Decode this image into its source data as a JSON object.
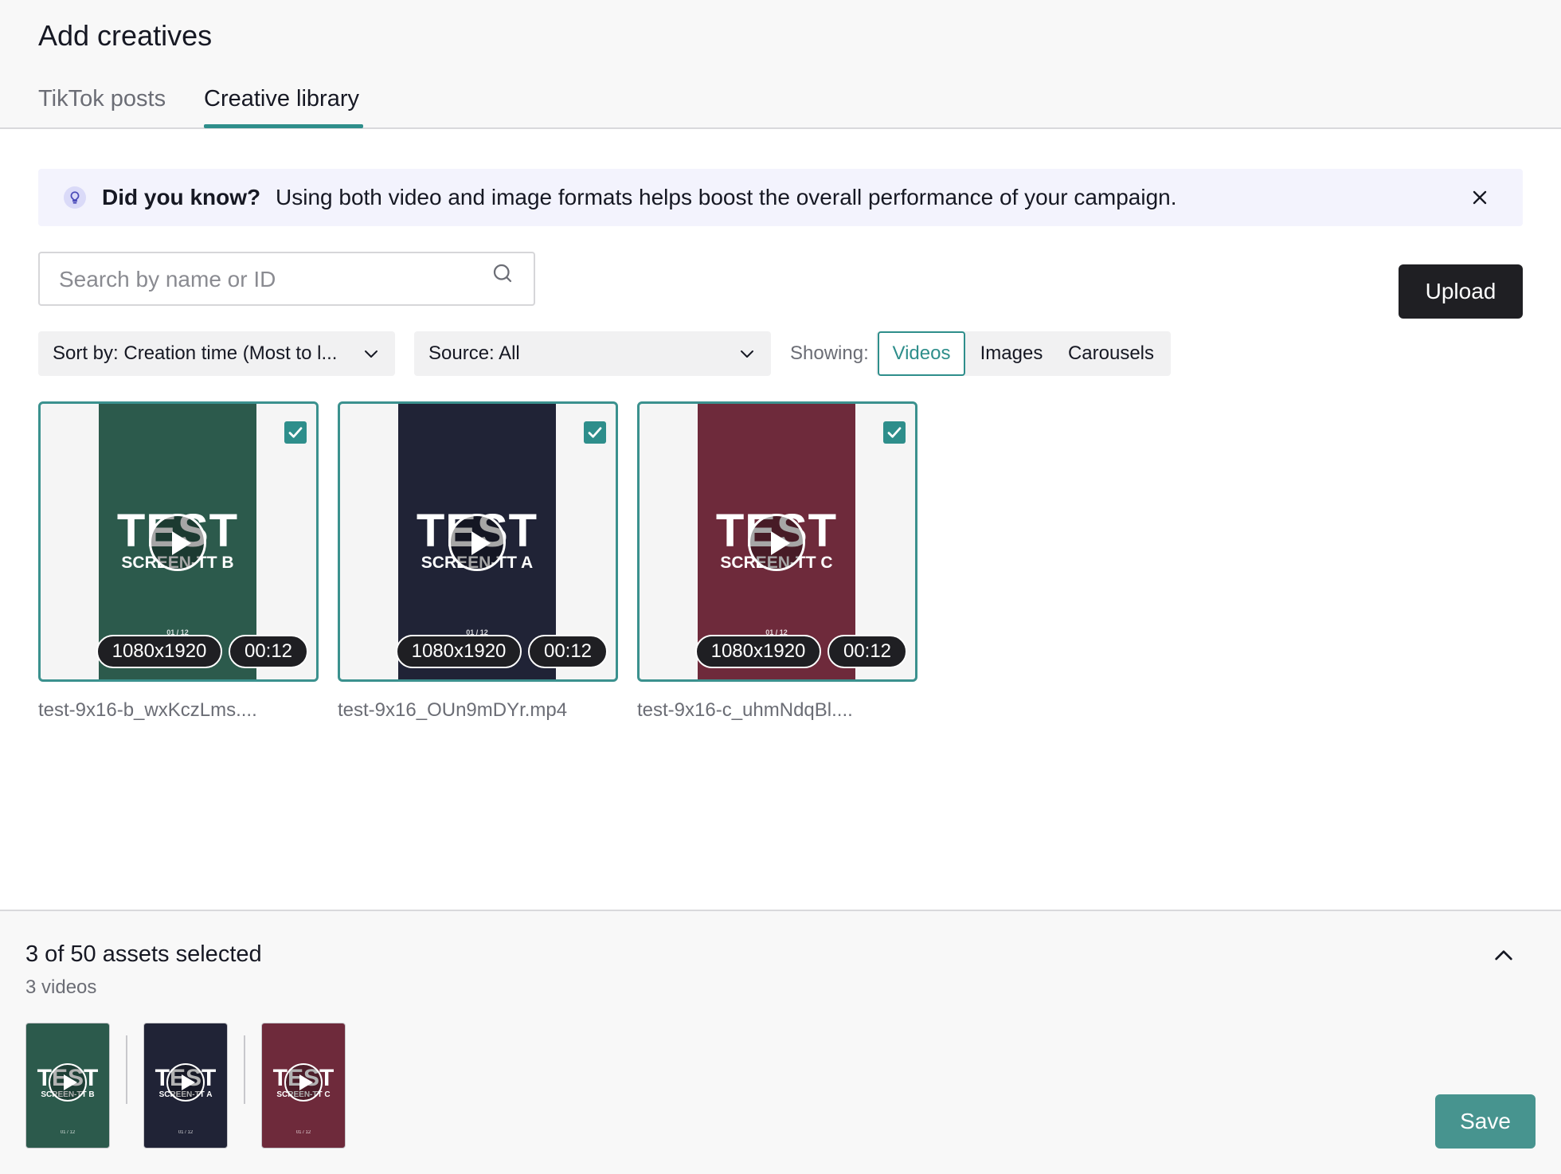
{
  "header": {
    "title": "Add creatives",
    "tabs": [
      {
        "label": "TikTok posts",
        "active": false
      },
      {
        "label": "Creative library",
        "active": true
      }
    ]
  },
  "banner": {
    "title": "Did you know?",
    "text": "Using both video and image formats helps boost the overall performance of your campaign."
  },
  "search": {
    "placeholder": "Search by name or ID"
  },
  "upload_label": "Upload",
  "filters": {
    "sort": {
      "label": "Sort by:",
      "value": "Creation time (Most to l..."
    },
    "source": {
      "label": "Source:",
      "value": "All"
    },
    "showing_label": "Showing:",
    "showing_options": [
      "Videos",
      "Images",
      "Carousels"
    ],
    "showing_selected": "Videos"
  },
  "assets": [
    {
      "name": "test-9x16-b_wxKczLms....",
      "resolution": "1080x1920",
      "duration": "00:12",
      "thumb_title": "TEST",
      "thumb_sub": "SCREEN-TT B",
      "thumb_foot": "01 / 12",
      "color": "#2c5a4c",
      "selected": true
    },
    {
      "name": "test-9x16_OUn9mDYr.mp4",
      "resolution": "1080x1920",
      "duration": "00:12",
      "thumb_title": "TEST",
      "thumb_sub": "SCREEN-TT A",
      "thumb_foot": "01 / 12",
      "color": "#202336",
      "selected": true
    },
    {
      "name": "test-9x16-c_uhmNdqBl....",
      "resolution": "1080x1920",
      "duration": "00:12",
      "thumb_title": "TEST",
      "thumb_sub": "SCREEN-TT C",
      "thumb_foot": "01 / 12",
      "color": "#6e2a3b",
      "selected": true
    }
  ],
  "footer": {
    "selected_text": "3 of 50 assets selected",
    "sub_text": "3 videos",
    "save_label": "Save"
  },
  "colors": {
    "accent": "#2e8e8b",
    "banner_bg": "#f3f3fd",
    "upload_bg": "#1f1f23"
  }
}
